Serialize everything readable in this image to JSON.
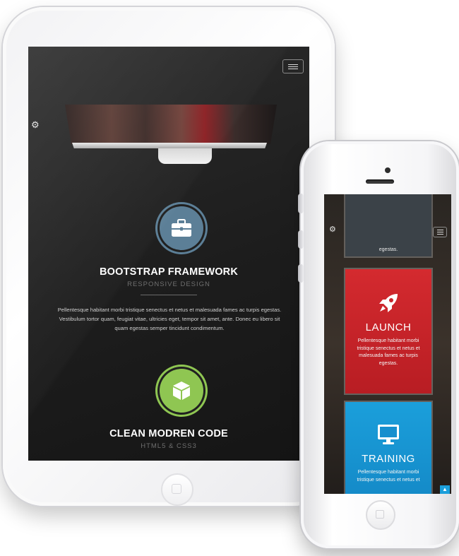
{
  "tablet": {
    "features": [
      {
        "title": "BOOTSTRAP FRAMEWORK",
        "subtitle": "RESPONSIVE DESIGN",
        "body": "Pellentesque habitant morbi tristique senectus et netus et malesuada fames ac turpis egestas.\nVestibulum tortor quam, feugiat vitae, ultricies eget, tempor sit amet, ante. Donec eu libero sit\nquam egestas semper tincidunt condimentum.",
        "icon": "briefcase-icon",
        "color": "#5c7f97"
      },
      {
        "title": "CLEAN MODREN CODE",
        "subtitle": "HTML5 & CSS3",
        "icon": "cube-icon",
        "color": "#8fc652"
      }
    ]
  },
  "phone": {
    "top_tile_tail": "egestas.",
    "tiles": [
      {
        "title": "LAUNCH",
        "body": "Pellentesque habitant morbi\ntristique senectus et netus et\nmalesuada fames ac turpis\negestas.",
        "icon": "rocket-icon",
        "color": "#d42a2f"
      },
      {
        "title": "TRAINING",
        "body": "Pellentesque habitant morbi\ntristique senectus et netus et",
        "icon": "monitor-icon",
        "color": "#1b9fdb"
      }
    ]
  },
  "icons": {
    "gear": "⚙",
    "scroll_top": "▲"
  }
}
